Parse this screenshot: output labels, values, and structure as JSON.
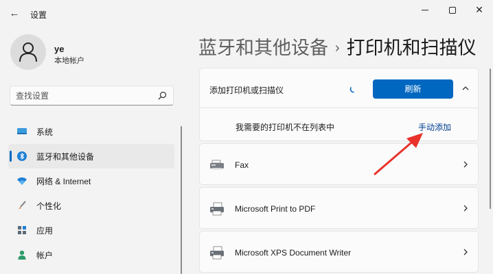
{
  "window": {
    "back_glyph": "←",
    "title": "设置",
    "minimize_glyph": "─",
    "close_glyph": "✕"
  },
  "user": {
    "name": "ye",
    "account_type": "本地帐户"
  },
  "search": {
    "placeholder": "查找设置",
    "icon": "search-icon"
  },
  "sidebar": {
    "items": [
      {
        "label": "系统",
        "icon": "monitor-icon",
        "active": false
      },
      {
        "label": "蓝牙和其他设备",
        "icon": "bluetooth-icon",
        "active": true
      },
      {
        "label": "网络 & Internet",
        "icon": "wifi-icon",
        "active": false
      },
      {
        "label": "个性化",
        "icon": "brush-icon",
        "active": false
      },
      {
        "label": "应用",
        "icon": "apps-icon",
        "active": false
      },
      {
        "label": "帐户",
        "icon": "person-icon",
        "active": false
      }
    ]
  },
  "breadcrumb": {
    "parent": "蓝牙和其他设备",
    "separator": "›",
    "current": "打印机和扫描仪"
  },
  "add_printer": {
    "label": "添加打印机或扫描仪",
    "refresh_label": "刷新",
    "missing_label": "我需要的打印机不在列表中",
    "manual_add_label": "手动添加"
  },
  "printers": [
    {
      "name": "Fax",
      "icon": "fax-icon"
    },
    {
      "name": "Microsoft Print to PDF",
      "icon": "printer-icon"
    },
    {
      "name": "Microsoft XPS Document Writer",
      "icon": "printer-icon"
    }
  ],
  "colors": {
    "accent": "#0067c0",
    "link": "#003e92",
    "annotation_arrow": "#e8322a",
    "background": "#f3f3f3",
    "card": "#fbfbfb"
  }
}
